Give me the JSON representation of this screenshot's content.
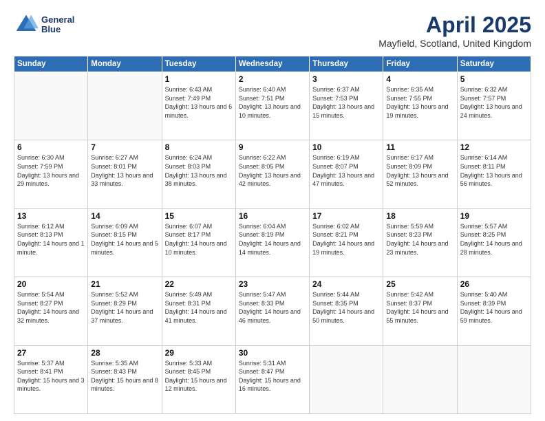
{
  "header": {
    "logo_line1": "General",
    "logo_line2": "Blue",
    "title": "April 2025",
    "subtitle": "Mayfield, Scotland, United Kingdom"
  },
  "days_of_week": [
    "Sunday",
    "Monday",
    "Tuesday",
    "Wednesday",
    "Thursday",
    "Friday",
    "Saturday"
  ],
  "weeks": [
    [
      {
        "day": "",
        "info": ""
      },
      {
        "day": "",
        "info": ""
      },
      {
        "day": "1",
        "info": "Sunrise: 6:43 AM\nSunset: 7:49 PM\nDaylight: 13 hours and 6 minutes."
      },
      {
        "day": "2",
        "info": "Sunrise: 6:40 AM\nSunset: 7:51 PM\nDaylight: 13 hours and 10 minutes."
      },
      {
        "day": "3",
        "info": "Sunrise: 6:37 AM\nSunset: 7:53 PM\nDaylight: 13 hours and 15 minutes."
      },
      {
        "day": "4",
        "info": "Sunrise: 6:35 AM\nSunset: 7:55 PM\nDaylight: 13 hours and 19 minutes."
      },
      {
        "day": "5",
        "info": "Sunrise: 6:32 AM\nSunset: 7:57 PM\nDaylight: 13 hours and 24 minutes."
      }
    ],
    [
      {
        "day": "6",
        "info": "Sunrise: 6:30 AM\nSunset: 7:59 PM\nDaylight: 13 hours and 29 minutes."
      },
      {
        "day": "7",
        "info": "Sunrise: 6:27 AM\nSunset: 8:01 PM\nDaylight: 13 hours and 33 minutes."
      },
      {
        "day": "8",
        "info": "Sunrise: 6:24 AM\nSunset: 8:03 PM\nDaylight: 13 hours and 38 minutes."
      },
      {
        "day": "9",
        "info": "Sunrise: 6:22 AM\nSunset: 8:05 PM\nDaylight: 13 hours and 42 minutes."
      },
      {
        "day": "10",
        "info": "Sunrise: 6:19 AM\nSunset: 8:07 PM\nDaylight: 13 hours and 47 minutes."
      },
      {
        "day": "11",
        "info": "Sunrise: 6:17 AM\nSunset: 8:09 PM\nDaylight: 13 hours and 52 minutes."
      },
      {
        "day": "12",
        "info": "Sunrise: 6:14 AM\nSunset: 8:11 PM\nDaylight: 13 hours and 56 minutes."
      }
    ],
    [
      {
        "day": "13",
        "info": "Sunrise: 6:12 AM\nSunset: 8:13 PM\nDaylight: 14 hours and 1 minute."
      },
      {
        "day": "14",
        "info": "Sunrise: 6:09 AM\nSunset: 8:15 PM\nDaylight: 14 hours and 5 minutes."
      },
      {
        "day": "15",
        "info": "Sunrise: 6:07 AM\nSunset: 8:17 PM\nDaylight: 14 hours and 10 minutes."
      },
      {
        "day": "16",
        "info": "Sunrise: 6:04 AM\nSunset: 8:19 PM\nDaylight: 14 hours and 14 minutes."
      },
      {
        "day": "17",
        "info": "Sunrise: 6:02 AM\nSunset: 8:21 PM\nDaylight: 14 hours and 19 minutes."
      },
      {
        "day": "18",
        "info": "Sunrise: 5:59 AM\nSunset: 8:23 PM\nDaylight: 14 hours and 23 minutes."
      },
      {
        "day": "19",
        "info": "Sunrise: 5:57 AM\nSunset: 8:25 PM\nDaylight: 14 hours and 28 minutes."
      }
    ],
    [
      {
        "day": "20",
        "info": "Sunrise: 5:54 AM\nSunset: 8:27 PM\nDaylight: 14 hours and 32 minutes."
      },
      {
        "day": "21",
        "info": "Sunrise: 5:52 AM\nSunset: 8:29 PM\nDaylight: 14 hours and 37 minutes."
      },
      {
        "day": "22",
        "info": "Sunrise: 5:49 AM\nSunset: 8:31 PM\nDaylight: 14 hours and 41 minutes."
      },
      {
        "day": "23",
        "info": "Sunrise: 5:47 AM\nSunset: 8:33 PM\nDaylight: 14 hours and 46 minutes."
      },
      {
        "day": "24",
        "info": "Sunrise: 5:44 AM\nSunset: 8:35 PM\nDaylight: 14 hours and 50 minutes."
      },
      {
        "day": "25",
        "info": "Sunrise: 5:42 AM\nSunset: 8:37 PM\nDaylight: 14 hours and 55 minutes."
      },
      {
        "day": "26",
        "info": "Sunrise: 5:40 AM\nSunset: 8:39 PM\nDaylight: 14 hours and 59 minutes."
      }
    ],
    [
      {
        "day": "27",
        "info": "Sunrise: 5:37 AM\nSunset: 8:41 PM\nDaylight: 15 hours and 3 minutes."
      },
      {
        "day": "28",
        "info": "Sunrise: 5:35 AM\nSunset: 8:43 PM\nDaylight: 15 hours and 8 minutes."
      },
      {
        "day": "29",
        "info": "Sunrise: 5:33 AM\nSunset: 8:45 PM\nDaylight: 15 hours and 12 minutes."
      },
      {
        "day": "30",
        "info": "Sunrise: 5:31 AM\nSunset: 8:47 PM\nDaylight: 15 hours and 16 minutes."
      },
      {
        "day": "",
        "info": ""
      },
      {
        "day": "",
        "info": ""
      },
      {
        "day": "",
        "info": ""
      }
    ]
  ]
}
